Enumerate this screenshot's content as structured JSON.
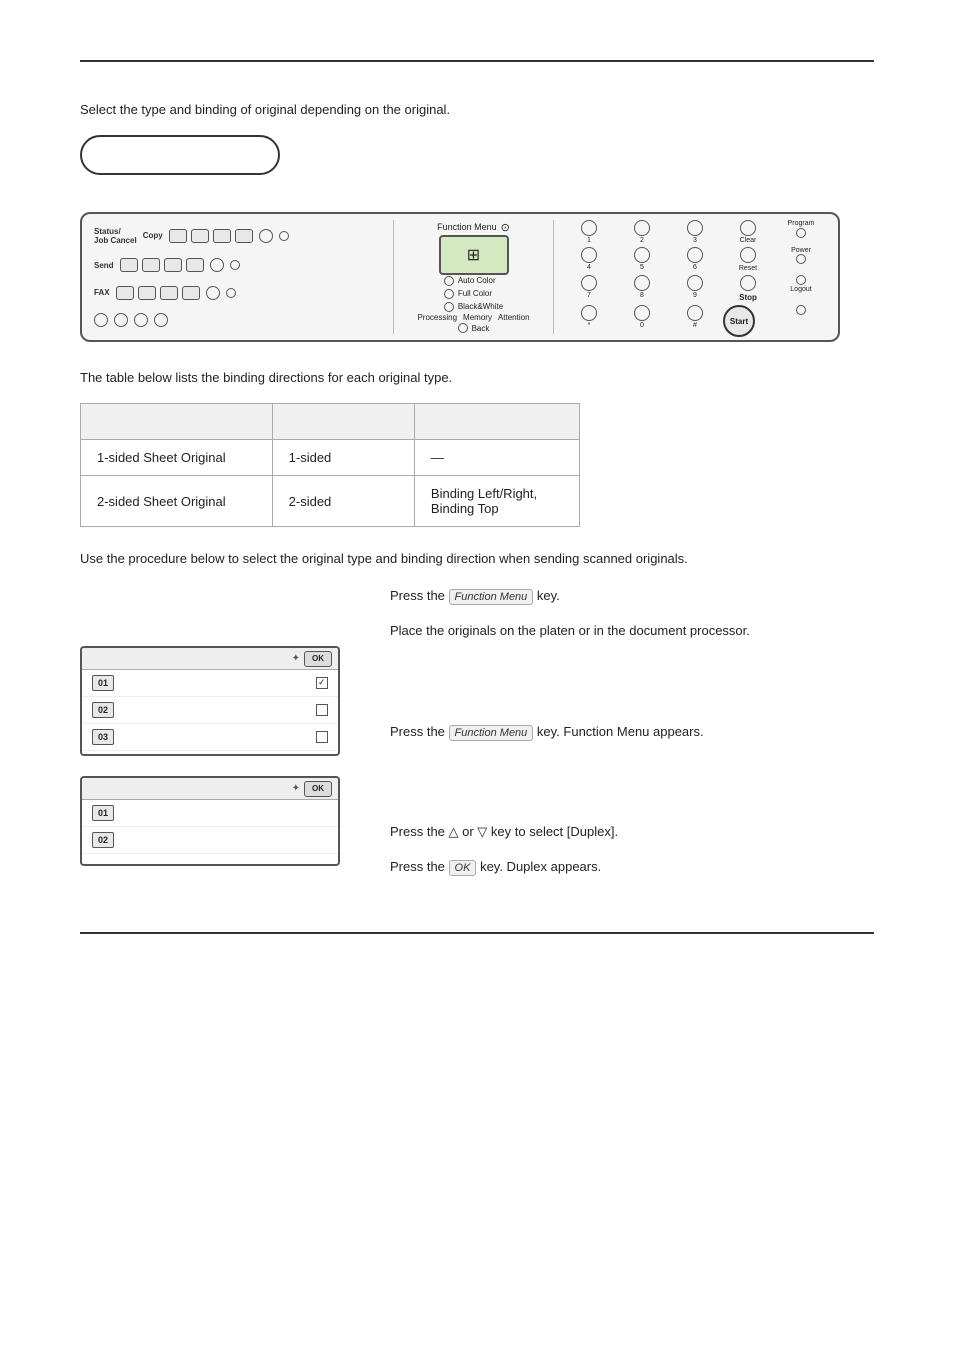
{
  "page": {
    "top_rule": true,
    "bottom_rule": true,
    "intro_text": "Select the type and binding of original depending on the original.",
    "table_intro": "The table below lists the binding directions for each original type.",
    "procedure_intro": "Use the procedure below to select the original type and binding direction when sending scanned originals.",
    "table": {
      "headers": [
        "",
        "",
        ""
      ],
      "rows": [
        [
          "1-sided Sheet Original",
          "1-sided",
          "—"
        ],
        [
          "2-sided Sheet Original",
          "2-sided",
          "Binding Left/Right,\nBinding Top"
        ]
      ]
    },
    "steps": [
      {
        "id": 1,
        "text": "Press the",
        "key": "Function Menu",
        "suffix": "key."
      },
      {
        "id": 2,
        "text": "Place the originals on the platen or in the document processor."
      },
      {
        "id": 3,
        "text": "Press the",
        "key": "Function Menu",
        "suffix": "key. Function Menu appears."
      },
      {
        "id": 4,
        "text": "Press the △ or ▽ key to select [Duplex]."
      },
      {
        "id": 5,
        "text": "Press the",
        "key": "OK",
        "suffix": "key. Duplex appears."
      }
    ],
    "screen1": {
      "nav_icon": "✦",
      "ok_label": "OK",
      "rows": [
        {
          "num": "01",
          "label": "",
          "checked": true
        },
        {
          "num": "02",
          "label": "",
          "checked": false
        },
        {
          "num": "03",
          "label": "",
          "checked": false
        }
      ]
    },
    "screen2": {
      "nav_icon": "✦",
      "ok_label": "OK",
      "rows": [
        {
          "num": "01",
          "label": "",
          "checked": false
        },
        {
          "num": "02",
          "label": "",
          "checked": false
        }
      ]
    },
    "panel": {
      "copy_label": "Copy",
      "send_label": "Send",
      "fax_label": "FAX",
      "function_menu_label": "Function Menu",
      "back_label": "Back",
      "stop_label": "Stop",
      "start_label": "Start",
      "clear_label": "Clear",
      "reset_label": "Reset",
      "logout_label": "Logout",
      "auto_color_label": "Auto Color",
      "full_color_label": "Full Color",
      "black_white_label": "Black&White",
      "processing_label": "Processing",
      "memory_label": "Memory",
      "attention_label": "Attention",
      "nums": [
        "1",
        "2",
        "3",
        "4",
        "5",
        "6",
        "7",
        "8",
        "9",
        "*",
        "0",
        "#"
      ]
    }
  }
}
